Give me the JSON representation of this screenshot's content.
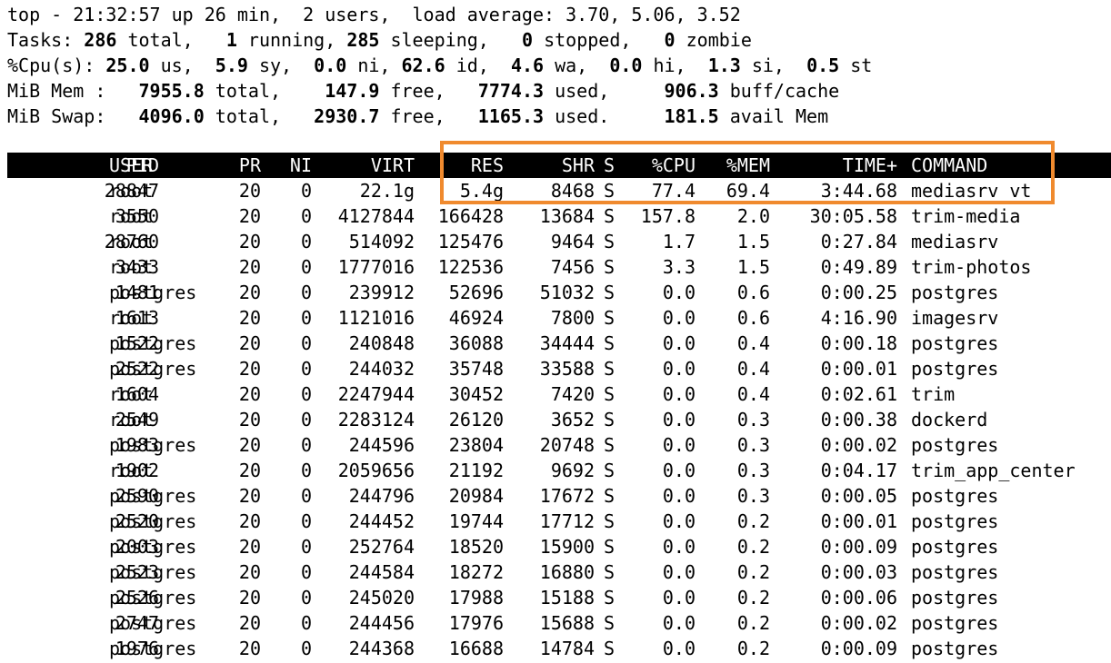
{
  "summary": {
    "line1": "top - 21:32:57 up 26 min,  2 users,  load average: 3.70, 5.06, 3.52",
    "tasks": {
      "label": "Tasks: ",
      "total": "286",
      "total_label": " total,   ",
      "running": "1",
      "running_label": " running, ",
      "sleeping": "285",
      "sleeping_label": " sleeping,   ",
      "stopped": "0",
      "stopped_label": " stopped,   ",
      "zombie": "0",
      "zombie_label": " zombie"
    },
    "cpu": {
      "label": "%Cpu(s): ",
      "us": "25.0",
      "us_label": " us,  ",
      "sy": "5.9",
      "sy_label": " sy,  ",
      "ni": "0.0",
      "ni_label": " ni, ",
      "id": "62.6",
      "id_label": " id,  ",
      "wa": "4.6",
      "wa_label": " wa,  ",
      "hi": "0.0",
      "hi_label": " hi,  ",
      "si": "1.3",
      "si_label": " si,  ",
      "st": "0.5",
      "st_label": " st"
    },
    "mem": {
      "label": "MiB Mem :   ",
      "total": "7955.8",
      "total_label": " total,    ",
      "free": "147.9",
      "free_label": " free,   ",
      "used": "7774.3",
      "used_label": " used,     ",
      "buff": "906.3",
      "buff_label": " buff/cache"
    },
    "swap": {
      "label": "MiB Swap:   ",
      "total": "4096.0",
      "total_label": " total,   ",
      "free": "2930.7",
      "free_label": " free,   ",
      "used": "1165.3",
      "used_label": " used.     ",
      "avail": "181.5",
      "avail_label": " avail Mem"
    }
  },
  "table": {
    "headers": {
      "pid": "PID",
      "user": "USER",
      "pr": "PR",
      "ni": "NI",
      "virt": "VIRT",
      "res": "RES",
      "shr": "SHR",
      "s": "S",
      "cpu": "%CPU",
      "mem": "%MEM",
      "time": "TIME+",
      "command": "COMMAND"
    },
    "rows": [
      {
        "pid": "28847",
        "user": "root",
        "pr": "20",
        "ni": "0",
        "virt": "22.1g",
        "res": "5.4g",
        "shr": "8468",
        "s": "S",
        "cpu": "77.4",
        "mem": "69.4",
        "time": "3:44.68",
        "command": "mediasrv_vt"
      },
      {
        "pid": "3550",
        "user": "root",
        "pr": "20",
        "ni": "0",
        "virt": "4127844",
        "res": "166428",
        "shr": "13684",
        "s": "S",
        "cpu": "157.8",
        "mem": "2.0",
        "time": "30:05.58",
        "command": "trim-media"
      },
      {
        "pid": "28760",
        "user": "root",
        "pr": "20",
        "ni": "0",
        "virt": "514092",
        "res": "125476",
        "shr": "9464",
        "s": "S",
        "cpu": "1.7",
        "mem": "1.5",
        "time": "0:27.84",
        "command": "mediasrv"
      },
      {
        "pid": "3433",
        "user": "root",
        "pr": "20",
        "ni": "0",
        "virt": "1777016",
        "res": "122536",
        "shr": "7456",
        "s": "S",
        "cpu": "3.3",
        "mem": "1.5",
        "time": "0:49.89",
        "command": "trim-photos"
      },
      {
        "pid": "1481",
        "user": "postgres",
        "pr": "20",
        "ni": "0",
        "virt": "239912",
        "res": "52696",
        "shr": "51032",
        "s": "S",
        "cpu": "0.0",
        "mem": "0.6",
        "time": "0:00.25",
        "command": "postgres"
      },
      {
        "pid": "1613",
        "user": "root",
        "pr": "20",
        "ni": "0",
        "virt": "1121016",
        "res": "46924",
        "shr": "7800",
        "s": "S",
        "cpu": "0.0",
        "mem": "0.6",
        "time": "4:16.90",
        "command": "imagesrv"
      },
      {
        "pid": "1522",
        "user": "postgres",
        "pr": "20",
        "ni": "0",
        "virt": "240848",
        "res": "36088",
        "shr": "34444",
        "s": "S",
        "cpu": "0.0",
        "mem": "0.4",
        "time": "0:00.18",
        "command": "postgres"
      },
      {
        "pid": "2522",
        "user": "postgres",
        "pr": "20",
        "ni": "0",
        "virt": "244032",
        "res": "35748",
        "shr": "33588",
        "s": "S",
        "cpu": "0.0",
        "mem": "0.4",
        "time": "0:00.01",
        "command": "postgres"
      },
      {
        "pid": "1604",
        "user": "root",
        "pr": "20",
        "ni": "0",
        "virt": "2247944",
        "res": "30452",
        "shr": "7420",
        "s": "S",
        "cpu": "0.0",
        "mem": "0.4",
        "time": "0:02.61",
        "command": "trim"
      },
      {
        "pid": "2549",
        "user": "root",
        "pr": "20",
        "ni": "0",
        "virt": "2283124",
        "res": "26120",
        "shr": "3652",
        "s": "S",
        "cpu": "0.0",
        "mem": "0.3",
        "time": "0:00.38",
        "command": "dockerd"
      },
      {
        "pid": "1983",
        "user": "postgres",
        "pr": "20",
        "ni": "0",
        "virt": "244596",
        "res": "23804",
        "shr": "20748",
        "s": "S",
        "cpu": "0.0",
        "mem": "0.3",
        "time": "0:00.02",
        "command": "postgres"
      },
      {
        "pid": "1902",
        "user": "root",
        "pr": "20",
        "ni": "0",
        "virt": "2059656",
        "res": "21192",
        "shr": "9692",
        "s": "S",
        "cpu": "0.0",
        "mem": "0.3",
        "time": "0:04.17",
        "command": "trim_app_center"
      },
      {
        "pid": "2590",
        "user": "postgres",
        "pr": "20",
        "ni": "0",
        "virt": "244796",
        "res": "20984",
        "shr": "17672",
        "s": "S",
        "cpu": "0.0",
        "mem": "0.3",
        "time": "0:00.05",
        "command": "postgres"
      },
      {
        "pid": "2520",
        "user": "postgres",
        "pr": "20",
        "ni": "0",
        "virt": "244452",
        "res": "19744",
        "shr": "17712",
        "s": "S",
        "cpu": "0.0",
        "mem": "0.2",
        "time": "0:00.01",
        "command": "postgres"
      },
      {
        "pid": "2003",
        "user": "postgres",
        "pr": "20",
        "ni": "0",
        "virt": "252764",
        "res": "18520",
        "shr": "15900",
        "s": "S",
        "cpu": "0.0",
        "mem": "0.2",
        "time": "0:00.09",
        "command": "postgres"
      },
      {
        "pid": "2523",
        "user": "postgres",
        "pr": "20",
        "ni": "0",
        "virt": "244584",
        "res": "18272",
        "shr": "16880",
        "s": "S",
        "cpu": "0.0",
        "mem": "0.2",
        "time": "0:00.03",
        "command": "postgres"
      },
      {
        "pid": "2526",
        "user": "postgres",
        "pr": "20",
        "ni": "0",
        "virt": "245020",
        "res": "17988",
        "shr": "15188",
        "s": "S",
        "cpu": "0.0",
        "mem": "0.2",
        "time": "0:00.06",
        "command": "postgres"
      },
      {
        "pid": "2747",
        "user": "postgres",
        "pr": "20",
        "ni": "0",
        "virt": "244456",
        "res": "17976",
        "shr": "15688",
        "s": "S",
        "cpu": "0.0",
        "mem": "0.2",
        "time": "0:00.02",
        "command": "postgres"
      },
      {
        "pid": "1976",
        "user": "postgres",
        "pr": "20",
        "ni": "0",
        "virt": "244368",
        "res": "16688",
        "shr": "14784",
        "s": "S",
        "cpu": "0.0",
        "mem": "0.2",
        "time": "0:00.09",
        "command": "postgres"
      }
    ]
  },
  "colors": {
    "highlight_border": "#f08a2e",
    "header_background": "#000000",
    "header_text": "#ffffff",
    "text": "#000000",
    "background": "#ffffff"
  }
}
